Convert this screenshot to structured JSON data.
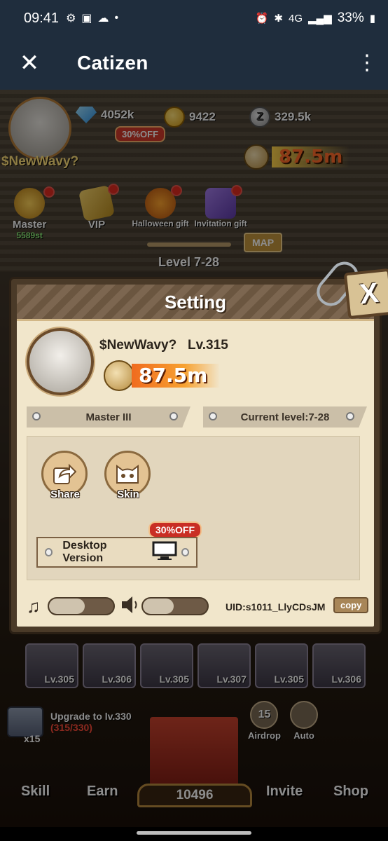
{
  "status_bar": {
    "time": "09:41",
    "network": "4G",
    "battery": "33%"
  },
  "title_bar": {
    "title": "Catizen"
  },
  "game": {
    "gems": "4052k",
    "coins": "9422",
    "zcoins": "329.5k",
    "z_symbol": "Z",
    "player_name": "$NewWavy?",
    "power": "87.5m",
    "discount_badge": "30%OFF",
    "top_buttons": [
      {
        "label": "Master",
        "sub": "5589st"
      },
      {
        "label": "VIP"
      },
      {
        "label": "Halloween gift"
      },
      {
        "label": "Invitation gift"
      }
    ],
    "level": "Level 7-28",
    "map_label": "MAP",
    "cards": [
      "Lv.305",
      "Lv.306",
      "Lv.305",
      "Lv.307",
      "Lv.305",
      "Lv.306"
    ],
    "upgrade": {
      "title": "Upgrade to lv.330",
      "progress": "(315/330)",
      "count": "x15"
    },
    "side_buttons": [
      {
        "label": "Airdrop",
        "num": "15"
      },
      {
        "label": "Auto"
      }
    ],
    "chest_count": "10496",
    "bottom_nav": [
      "Skill",
      "Earn",
      "Invite",
      "Shop"
    ]
  },
  "settings": {
    "title": "Setting",
    "close_label": "X",
    "name": "$NewWavy?",
    "level": "Lv.315",
    "power": "87.5m",
    "rank": "Master III",
    "current_level": "Current level:7-28",
    "actions": [
      {
        "label": "Share"
      },
      {
        "label": "Skin"
      }
    ],
    "desktop_version": "Desktop Version",
    "desktop_discount": "30%OFF",
    "music_level": 0.55,
    "sound_level": 0.48,
    "uid": "UID:s1011_LlyCDsJM",
    "copy_label": "copy"
  }
}
